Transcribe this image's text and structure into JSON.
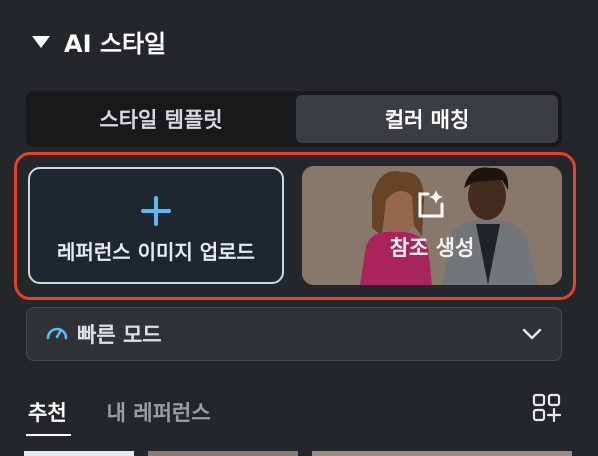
{
  "section": {
    "title": "AI 스타일"
  },
  "style_tabs": [
    {
      "label": "스타일 템플릿",
      "active": false
    },
    {
      "label": "컬러 매칭",
      "active": true
    }
  ],
  "upload_card": {
    "label": "레퍼런스 이미지 업로드",
    "icon": "plus-icon"
  },
  "reference_card": {
    "label": "참조 생성",
    "icon": "sparkle-frame-icon"
  },
  "mode_select": {
    "value": "빠른 모드",
    "icon": "speedometer-icon"
  },
  "bottom_tabs": [
    {
      "label": "추천",
      "active": true
    },
    {
      "label": "내 레퍼런스",
      "active": false
    }
  ],
  "colors": {
    "accent": "#5fb9ef",
    "highlight": "#e4412a",
    "background": "#24272a"
  }
}
